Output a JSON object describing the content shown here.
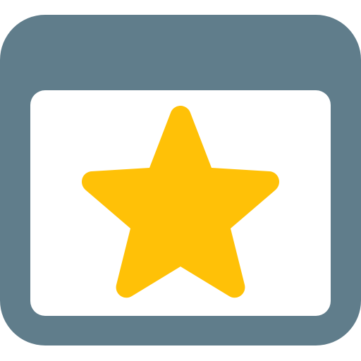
{
  "icon": {
    "name": "browser-window-star-icon",
    "frame_color": "#607D8B",
    "content_color": "#FFFFFF",
    "star_color": "#FFC107"
  }
}
